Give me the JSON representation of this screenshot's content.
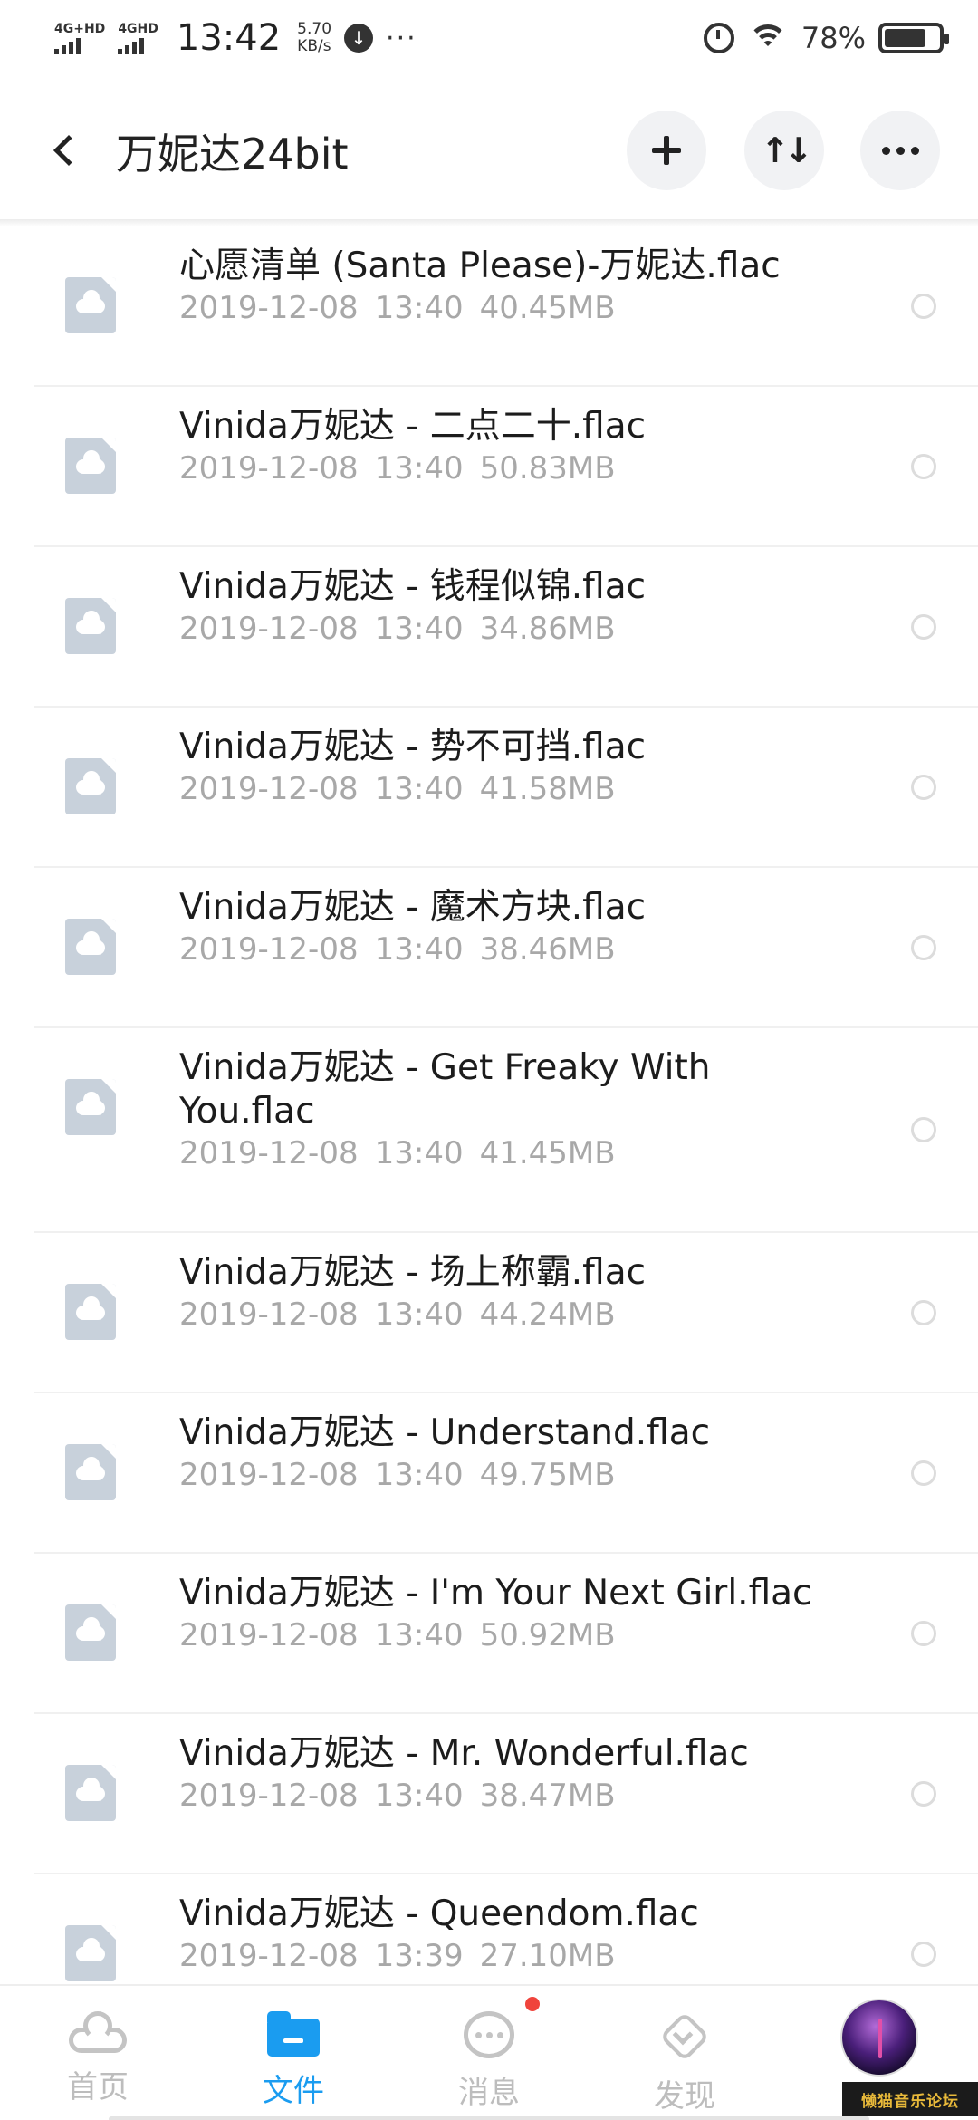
{
  "status_bar": {
    "signal1_label": "4G+HD",
    "signal2_label": "4GHD",
    "time": "13:42",
    "speed_value": "5.70",
    "speed_unit": "KB/s",
    "more": "···",
    "battery_percent": "78%",
    "battery_level": 0.78,
    "icons": [
      "download-icon",
      "alarm-icon",
      "wifi-icon",
      "battery-icon"
    ]
  },
  "header": {
    "title": "万妮达24bit",
    "buttons": [
      "back-icon",
      "add-icon",
      "sort-icon",
      "more-icon"
    ]
  },
  "files": [
    {
      "name": "心愿清单 (Santa Please)-万妮达.flac",
      "date": "2019-12-08",
      "time": "13:40",
      "size": "40.45MB"
    },
    {
      "name": "Vinida万妮达 - 二点二十.flac",
      "date": "2019-12-08",
      "time": "13:40",
      "size": "50.83MB"
    },
    {
      "name": "Vinida万妮达 - 钱程似锦.flac",
      "date": "2019-12-08",
      "time": "13:40",
      "size": "34.86MB"
    },
    {
      "name": "Vinida万妮达 - 势不可挡.flac",
      "date": "2019-12-08",
      "time": "13:40",
      "size": "41.58MB"
    },
    {
      "name": "Vinida万妮达 - 魔术方块.flac",
      "date": "2019-12-08",
      "time": "13:40",
      "size": "38.46MB"
    },
    {
      "name": "Vinida万妮达 - Get Freaky With You.flac",
      "date": "2019-12-08",
      "time": "13:40",
      "size": "41.45MB"
    },
    {
      "name": "Vinida万妮达 - 场上称霸.flac",
      "date": "2019-12-08",
      "time": "13:40",
      "size": "44.24MB"
    },
    {
      "name": "Vinida万妮达 - Understand.flac",
      "date": "2019-12-08",
      "time": "13:40",
      "size": "49.75MB"
    },
    {
      "name": "Vinida万妮达 - I'm Your Next Girl.flac",
      "date": "2019-12-08",
      "time": "13:40",
      "size": "50.92MB"
    },
    {
      "name": "Vinida万妮达 - Mr. Wonderful.flac",
      "date": "2019-12-08",
      "time": "13:40",
      "size": "38.47MB"
    },
    {
      "name": "Vinida万妮达 - Queendom.flac",
      "date": "2019-12-08",
      "time": "13:39",
      "size": "27.10MB"
    }
  ],
  "bottom_nav": {
    "items": [
      {
        "label": "首页",
        "icon": "cloud-icon",
        "active": false
      },
      {
        "label": "文件",
        "icon": "folder-icon",
        "active": true
      },
      {
        "label": "消息",
        "icon": "message-icon",
        "active": false,
        "badge": true
      },
      {
        "label": "发现",
        "icon": "discover-icon",
        "active": false
      }
    ],
    "watermark": "懒猫音乐论坛",
    "accent_color": "#1a9cf0",
    "badge_color": "#f0443c"
  }
}
